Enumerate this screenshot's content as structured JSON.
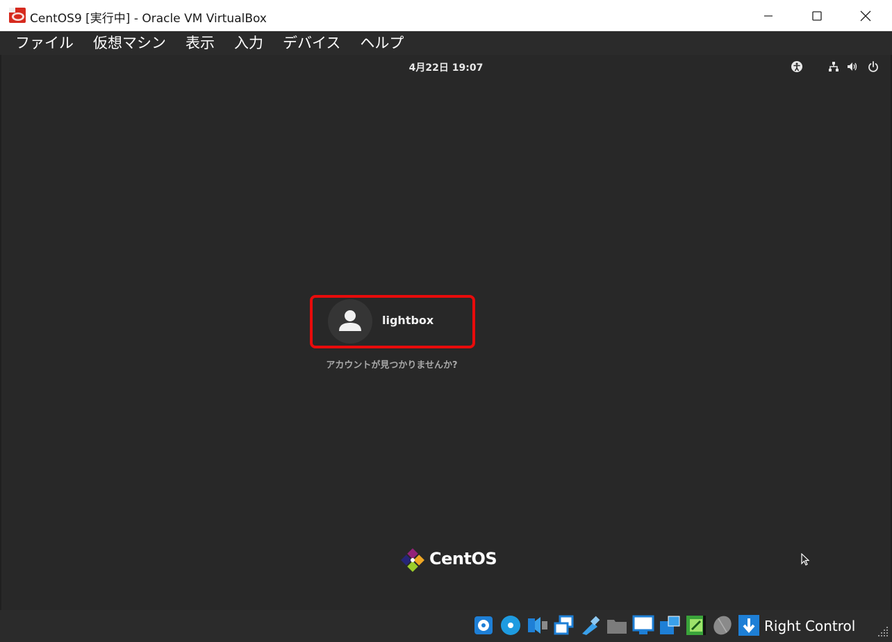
{
  "window": {
    "title": "CentOS9 [実行中] - Oracle VM VirtualBox",
    "app_icon": "virtualbox-vm-icon",
    "controls": [
      "minimize-icon",
      "maximize-icon",
      "close-icon"
    ]
  },
  "menubar": {
    "items": [
      {
        "label": "ファイル"
      },
      {
        "label": "仮想マシン"
      },
      {
        "label": "表示"
      },
      {
        "label": "入力"
      },
      {
        "label": "デバイス"
      },
      {
        "label": "ヘルプ"
      }
    ]
  },
  "gnome": {
    "clock": "4月22日  19:07",
    "system_icons": [
      "accessibility-icon",
      "network-icon",
      "volume-icon",
      "power-icon"
    ],
    "login": {
      "user_name": "lightbox",
      "not_listed": "アカウントが見つかりませんか?"
    },
    "distro_logo": "CentOS"
  },
  "statusbar": {
    "icons": [
      "hard-disk-icon",
      "optical-disk-icon",
      "audio-icon",
      "network-adapter-icon",
      "usb-icon",
      "shared-folders-icon",
      "display-icon",
      "recording-icon",
      "cpu-icon",
      "mouse-integration-icon",
      "host-key-arrow-icon"
    ],
    "host_key": "Right Control"
  },
  "colors": {
    "highlight": "#e80b0b",
    "vm_background": "#282828"
  }
}
